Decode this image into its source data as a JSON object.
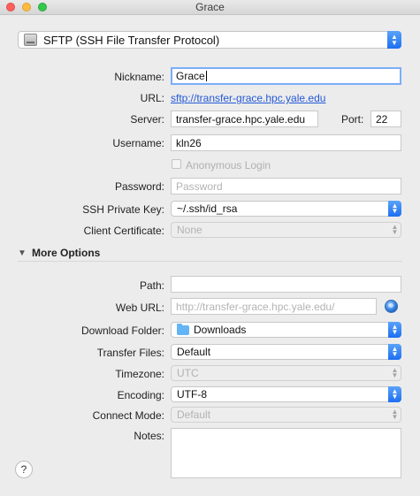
{
  "window": {
    "title": "Grace"
  },
  "protocol": {
    "selected": "SFTP (SSH File Transfer Protocol)",
    "icon": "drive-icon"
  },
  "form": {
    "nickname": {
      "label": "Nickname:",
      "value": "Grace"
    },
    "url": {
      "label": "URL:",
      "value": "sftp://transfer-grace.hpc.yale.edu"
    },
    "server": {
      "label": "Server:",
      "value": "transfer-grace.hpc.yale.edu"
    },
    "port": {
      "label": "Port:",
      "value": "22"
    },
    "username": {
      "label": "Username:",
      "value": "kln26"
    },
    "anonymous": {
      "label": "Anonymous Login",
      "checked": false
    },
    "password": {
      "label": "Password:",
      "placeholder": "Password"
    },
    "ssh_key": {
      "label": "SSH Private Key:",
      "value": "~/.ssh/id_rsa"
    },
    "client_cert": {
      "label": "Client Certificate:",
      "value": "None"
    }
  },
  "more_options": {
    "title": "More Options",
    "path": {
      "label": "Path:",
      "value": ""
    },
    "web_url": {
      "label": "Web URL:",
      "placeholder": "http://transfer-grace.hpc.yale.edu/"
    },
    "download_folder": {
      "label": "Download Folder:",
      "value": "Downloads"
    },
    "transfer_files": {
      "label": "Transfer Files:",
      "value": "Default"
    },
    "timezone": {
      "label": "Timezone:",
      "value": "UTC"
    },
    "encoding": {
      "label": "Encoding:",
      "value": "UTF-8"
    },
    "connect_mode": {
      "label": "Connect Mode:",
      "value": "Default"
    },
    "notes": {
      "label": "Notes:",
      "value": ""
    }
  },
  "help": {
    "label": "?"
  },
  "colors": {
    "accent": "#1d6ff2",
    "link": "#2359d6",
    "close": "#fc605c",
    "minimize": "#fdbc40",
    "maximize": "#34c84a"
  }
}
